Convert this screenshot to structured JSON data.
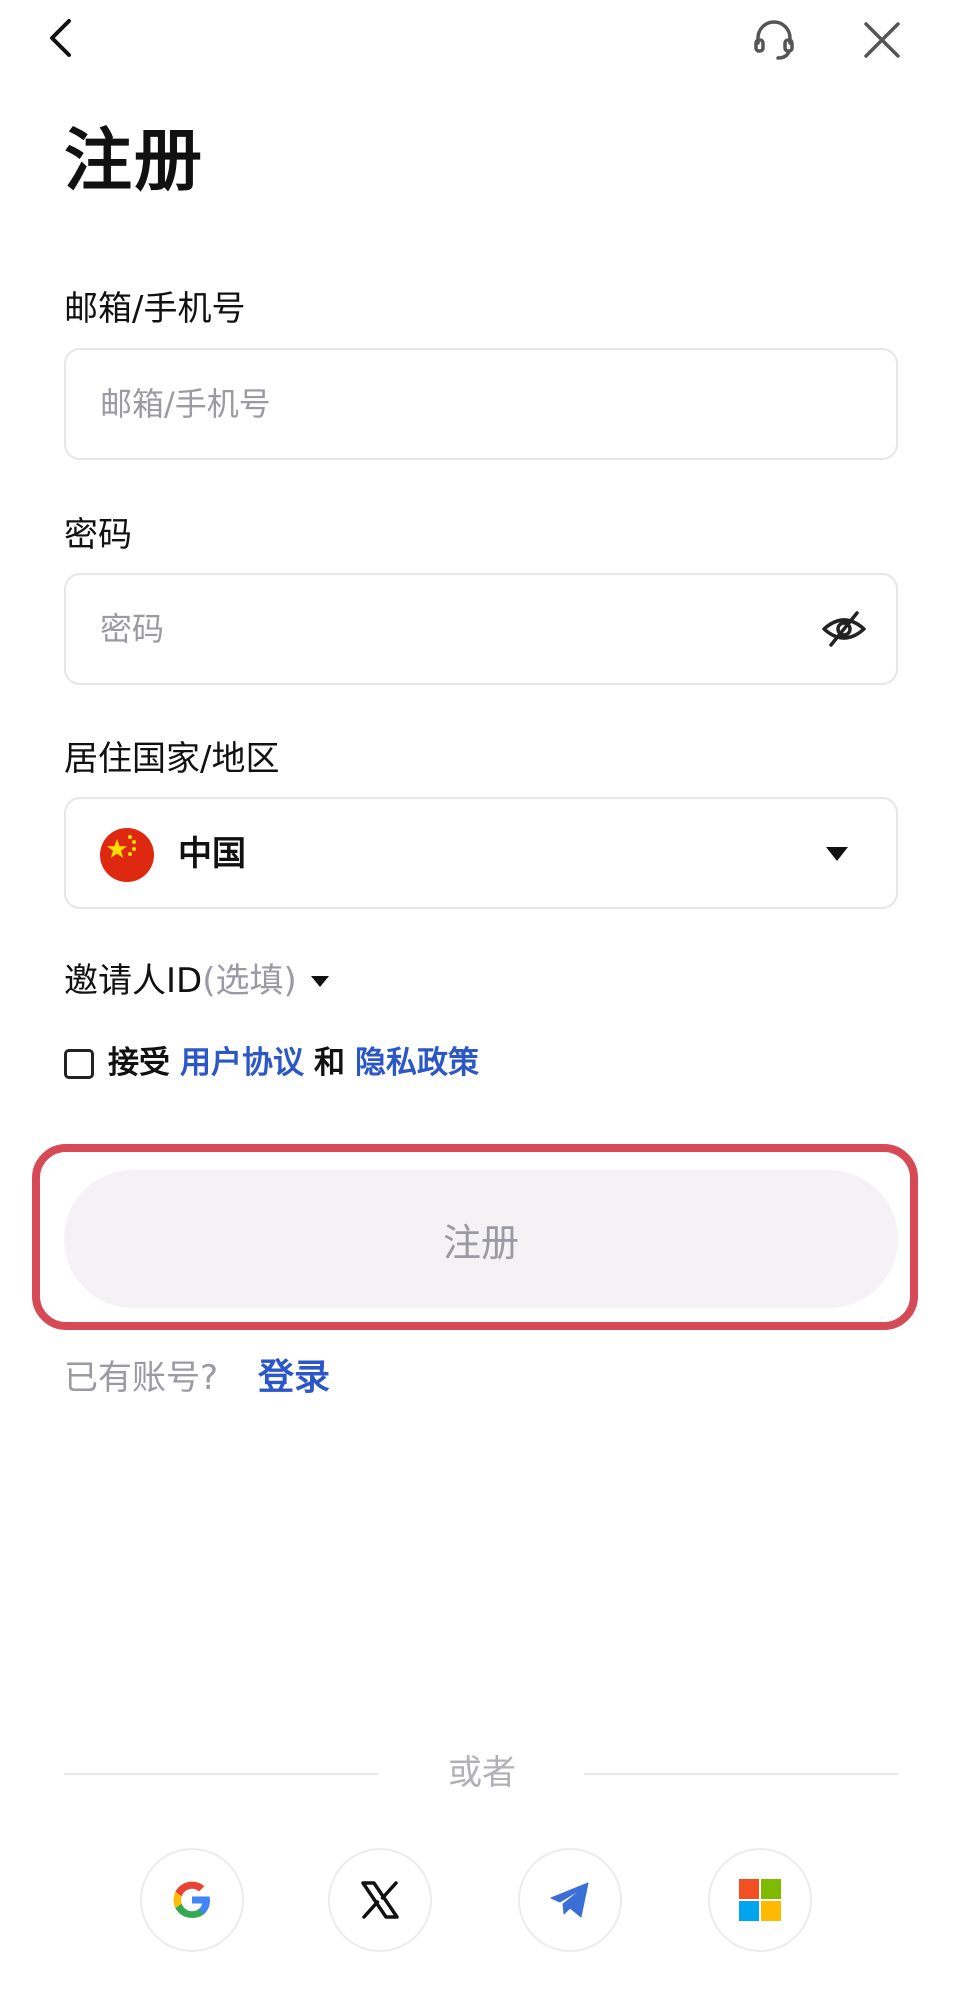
{
  "page": {
    "title": "注册"
  },
  "email": {
    "label": "邮箱/手机号",
    "placeholder": "邮箱/手机号"
  },
  "password": {
    "label": "密码",
    "placeholder": "密码"
  },
  "country": {
    "label": "居住国家/地区",
    "value": "中国"
  },
  "invite": {
    "label": "邀请人ID",
    "optional": "(选填)"
  },
  "agreement": {
    "accept": "接受",
    "user_agreement": "用户协议",
    "and": "和",
    "privacy_policy": "隐私政策",
    "checked": false
  },
  "register_button": {
    "label": "注册"
  },
  "login": {
    "prompt": "已有账号?",
    "link": "登录"
  },
  "divider": {
    "text": "或者"
  },
  "social_logins": [
    "google-icon",
    "x-icon",
    "telegram-icon",
    "microsoft-icon"
  ],
  "colors": {
    "link": "#2c57c7",
    "highlight_border": "#d64a55",
    "button_bg": "#f4f2f4",
    "muted_text": "#9a9aa2"
  }
}
